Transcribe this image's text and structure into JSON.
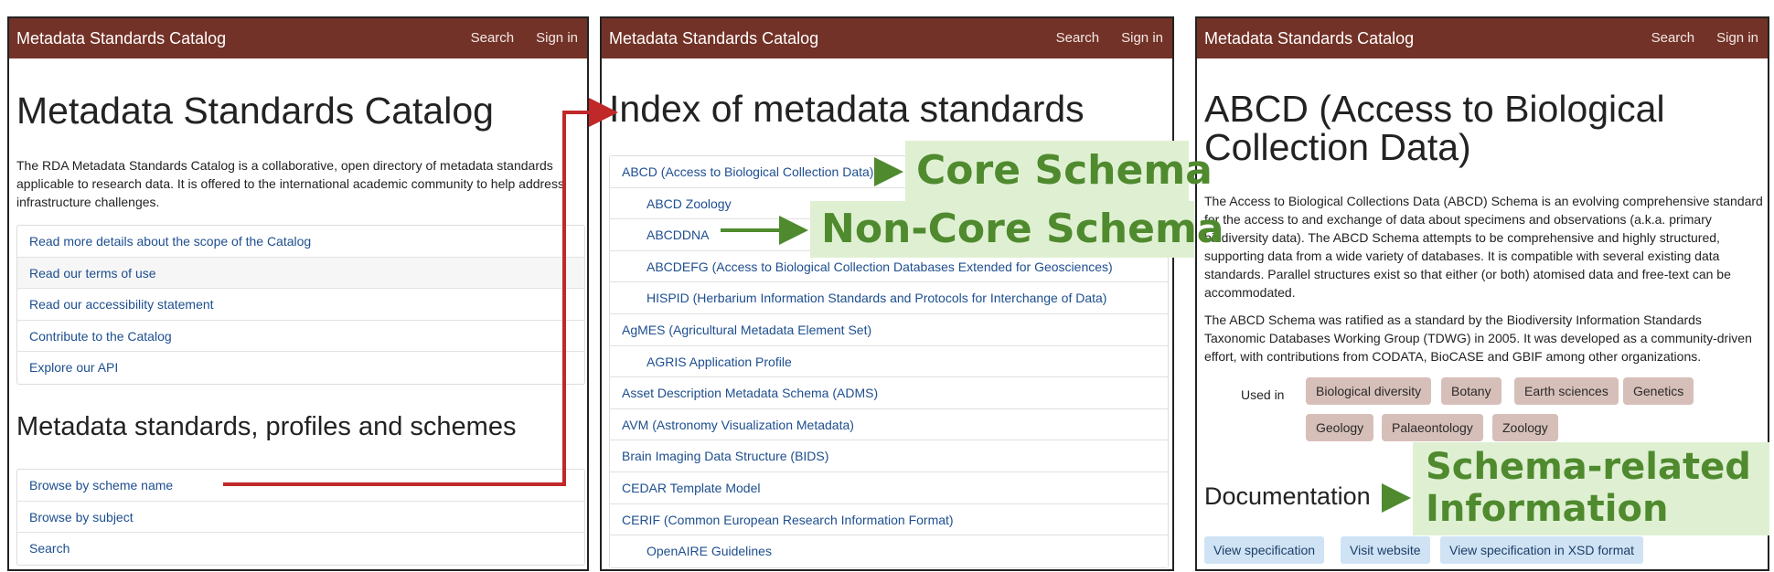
{
  "panel1": {
    "navbar": {
      "brand": "Metadata Standards Catalog",
      "search": "Search",
      "signin": "Sign in"
    },
    "title": "Metadata Standards Catalog",
    "intro": "The RDA Metadata Standards Catalog is a collaborative, open directory of metadata standards applicable to research data. It is offered to the international academic community to help address infrastructure challenges.",
    "links": [
      "Read more details about the scope of the Catalog",
      "Read our terms of use",
      "Read our accessibility statement",
      "Contribute to the Catalog",
      "Explore our API"
    ],
    "section_title": "Metadata standards, profiles and schemes",
    "browse": [
      "Browse by scheme name",
      "Browse by subject",
      "Search"
    ]
  },
  "panel2": {
    "navbar": {
      "brand": "Metadata Standards Catalog",
      "search": "Search",
      "signin": "Sign in"
    },
    "title": "Index of metadata standards",
    "items": [
      {
        "label": "ABCD (Access to Biological Collection Data)",
        "level": 0
      },
      {
        "label": "ABCD Zoology",
        "level": 1
      },
      {
        "label": "ABCDDNA",
        "level": 1
      },
      {
        "label": "ABCDEFG (Access to Biological Collection Databases Extended for Geosciences)",
        "level": 1
      },
      {
        "label": "HISPID (Herbarium Information Standards and Protocols for Interchange of Data)",
        "level": 1
      },
      {
        "label": "AgMES (Agricultural Metadata Element Set)",
        "level": 0
      },
      {
        "label": "AGRIS Application Profile",
        "level": 1
      },
      {
        "label": "Asset Description Metadata Schema (ADMS)",
        "level": 0
      },
      {
        "label": "AVM (Astronomy Visualization Metadata)",
        "level": 0
      },
      {
        "label": "Brain Imaging Data Structure (BIDS)",
        "level": 0
      },
      {
        "label": "CEDAR Template Model",
        "level": 0
      },
      {
        "label": "CERIF (Common European Research Information Format)",
        "level": 0
      },
      {
        "label": "OpenAIRE Guidelines",
        "level": 1
      }
    ]
  },
  "panel3": {
    "navbar": {
      "brand": "Metadata Standards Catalog",
      "search": "Search",
      "signin": "Sign in"
    },
    "title_line1": "ABCD (Access to Biological",
    "title_line2": "Collection Data)",
    "para1": "The Access to Biological Collections Data (ABCD) Schema is an evolving comprehensive standard for the access to and exchange of data about specimens and observations (a.k.a. primary biodiversity data). The ABCD Schema attempts to be comprehensive and highly structured, supporting data from a wide variety of databases. It is compatible with several existing data standards. Parallel structures exist so that either (or both) atomised data and free-text can be accommodated.",
    "para2": "The ABCD Schema was ratified as a standard by the Biodiversity Information Standards Taxonomic Databases Working Group (TDWG) in 2005. It was developed as a community-driven effort, with contributions from CODATA, BioCASE and GBIF among other organizations.",
    "used_in_label": "Used in",
    "tags": [
      "Biological diversity",
      "Botany",
      "Earth sciences",
      "Genetics",
      "Geology",
      "Palaeontology",
      "Zoology"
    ],
    "documentation_title": "Documentation",
    "doc_buttons": [
      "View specification",
      "Visit website",
      "View specification in XSD format"
    ]
  },
  "annotations": {
    "core_schema": "Core Schema",
    "non_core_schema": "Non-Core Schema",
    "schema_related_line1": "Schema-related",
    "schema_related_line2": "Information"
  },
  "colors": {
    "navbar": "#733227",
    "link": "#1d4e8f",
    "tag": "#d7bfb9",
    "doc_button": "#cfe3f5",
    "callout_bg": "#dff0d2",
    "callout_text": "#4f8a2e",
    "arrow_green": "#4f8a2e",
    "arrow_red": "#c0282a"
  }
}
